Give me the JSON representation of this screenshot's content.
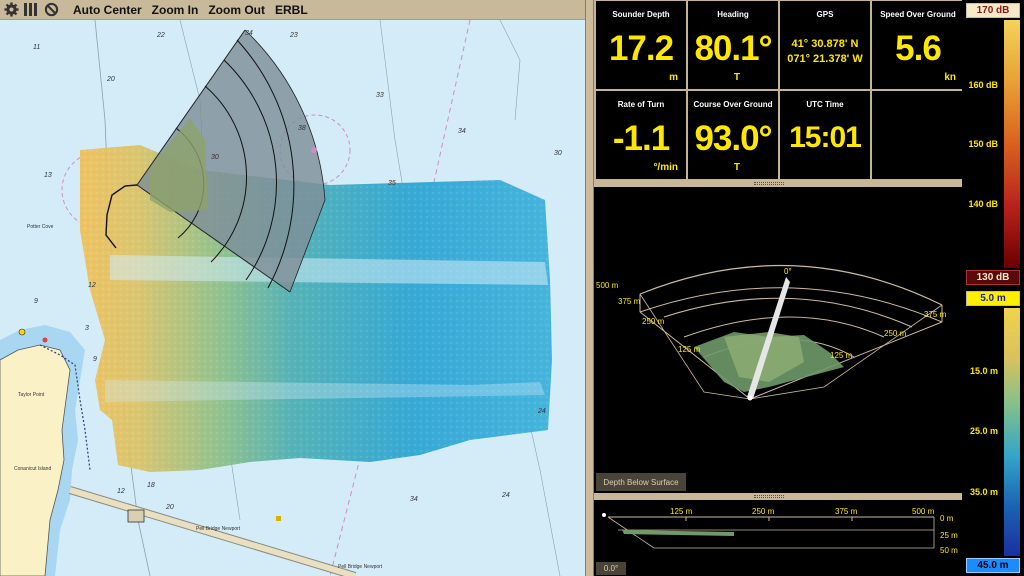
{
  "toolbar": {
    "auto_center": "Auto Center",
    "zoom_in": "Zoom In",
    "zoom_out": "Zoom Out",
    "erbl": "ERBL",
    "icons": [
      "gear-icon",
      "grid-icon",
      "no-icon"
    ]
  },
  "chart": {
    "soundings": [
      "11",
      "22",
      "23",
      "20",
      "33",
      "34",
      "38",
      "30",
      "30",
      "35",
      "13",
      "12",
      "9",
      "3",
      "9",
      "12",
      "20",
      "18",
      "34",
      "24",
      "24",
      "34"
    ],
    "place_labels": [
      "Potter Cove",
      "Taylor Point",
      "Conanicut Island",
      "Pell Bridge Newport",
      "Pell Bridge Newport"
    ]
  },
  "instruments": [
    {
      "title": "Sounder Depth",
      "value": "17.2",
      "unit": "m"
    },
    {
      "title": "Heading",
      "value": "80.1°",
      "unit": "T"
    },
    {
      "title": "GPS",
      "lat": "41° 30.878' N",
      "lon": "071° 21.378' W"
    },
    {
      "title": "Speed Over Ground",
      "value": "5.6",
      "unit": "kn"
    },
    {
      "title": "Rate of Turn",
      "value": "-1.1",
      "unit": "°/min"
    },
    {
      "title": "Course Over Ground",
      "value": "93.0°",
      "unit": "T"
    },
    {
      "title": "UTC Time",
      "value": "15:01",
      "unit": ""
    },
    {
      "title": "",
      "value": "",
      "unit": ""
    }
  ],
  "view3d": {
    "labels": {
      "deg0": "0°",
      "m500": "500 m",
      "m375l": "375 m",
      "m250l": "250 m",
      "m125l": "125 m",
      "m125r": "125 m",
      "m250r": "250 m",
      "m375r": "375 m"
    },
    "button": "Depth Below Surface"
  },
  "profile": {
    "labels": {
      "x125": "125 m",
      "x250": "250 m",
      "x375": "375 m",
      "x500": "500 m",
      "d0": "0 m",
      "d25": "25 m",
      "d50": "50 m"
    },
    "angle_button": "0.0°"
  },
  "colorbar_db": {
    "top": "170 dB",
    "bottom": "130 dB",
    "ticks": [
      "160 dB",
      "150 dB",
      "140 dB"
    ],
    "colors": [
      "#f3d35a",
      "#e8a134",
      "#d9611f",
      "#b9221c",
      "#6a0000"
    ]
  },
  "colorbar_depth": {
    "top": "5.0 m",
    "bottom": "45.0 m",
    "ticks": [
      "15.0 m",
      "25.0 m",
      "35.0 m"
    ],
    "colors": [
      "#f1d34d",
      "#d9c25d",
      "#7fc08e",
      "#33a4c9",
      "#1b63b2",
      "#1b2fa0"
    ]
  }
}
